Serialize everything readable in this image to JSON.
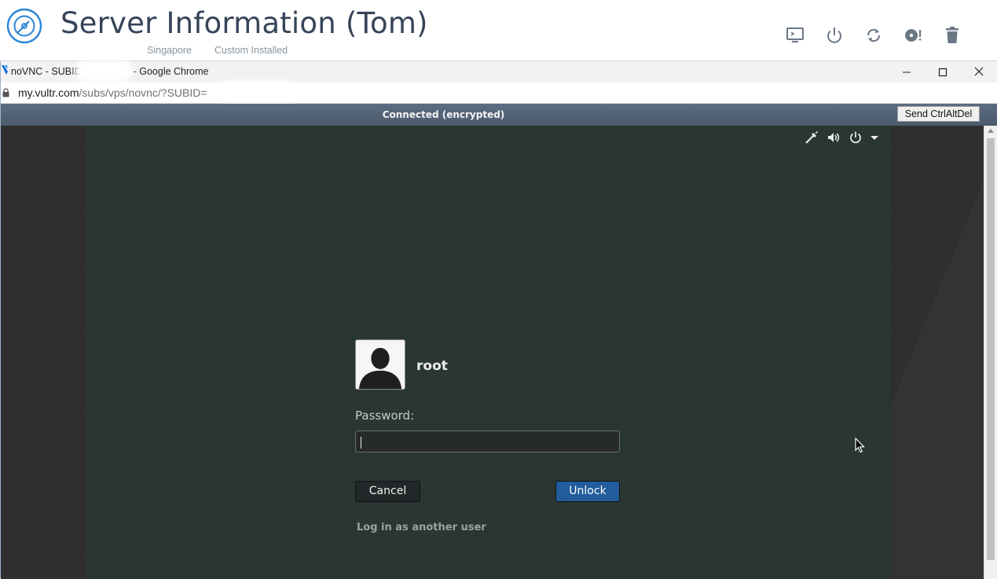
{
  "header": {
    "title": "Server Information (Tom)",
    "location": "Singapore",
    "os": "Custom Installed",
    "actions": [
      {
        "name": "view-console-icon"
      },
      {
        "name": "power-icon"
      },
      {
        "name": "restart-icon"
      },
      {
        "name": "reinstall-disk-icon"
      },
      {
        "name": "trash-icon"
      }
    ]
  },
  "chrome": {
    "window_title_prefix": "noVNC - SUBID",
    "window_title_suffix": "- Google Chrome",
    "url_host": "my.vultr.com",
    "url_path": "/subs/vps/novnc/?SUBID="
  },
  "novnc": {
    "status": "Connected (encrypted)",
    "send_cad_label": "Send CtrlAltDel"
  },
  "lockscreen": {
    "username": "root",
    "password_label": "Password:",
    "password_value": "",
    "cancel_label": "Cancel",
    "unlock_label": "Unlock",
    "other_user_label": "Log in as another user",
    "accent_color": "#215d9c"
  }
}
